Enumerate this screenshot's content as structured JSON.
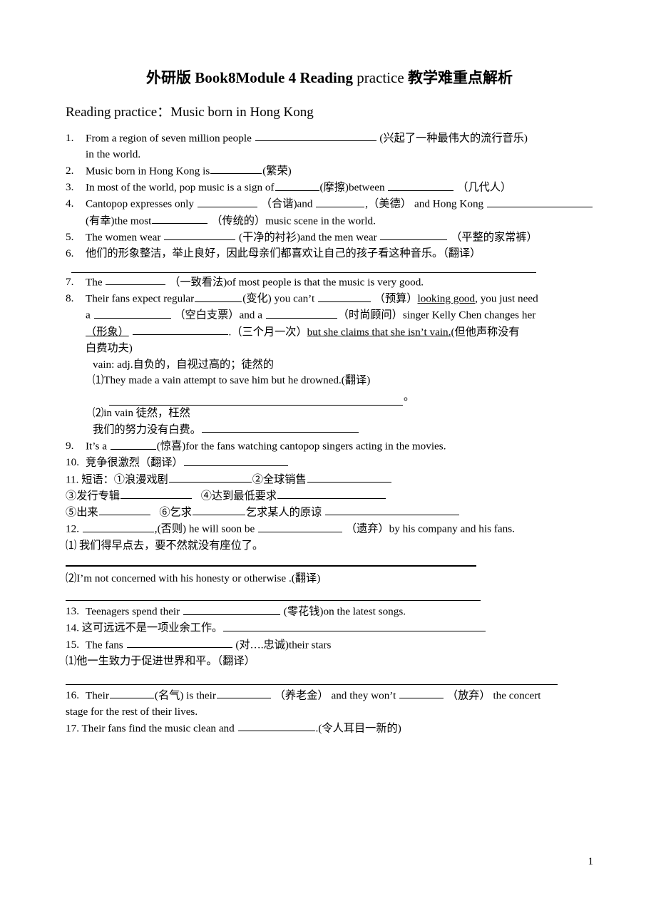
{
  "document": {
    "title_bold_cn_1": "外研版",
    "title_bold_en": "Book8Module 4 Reading",
    "title_light_en": "practice",
    "title_bold_cn_2": "教学难重点解析",
    "section_title": "Reading practice：Music born in Hong Kong",
    "page_number": "1"
  },
  "items": {
    "q1": {
      "num": "1.",
      "line1_a": "From a region of seven million people",
      "line1_b": "(兴起了一种最伟大的流行音乐)",
      "line2": "in the world."
    },
    "q2": {
      "num": "2.",
      "text_a": "Music born in Hong Kong is",
      "text_b": "(繁荣)"
    },
    "q3": {
      "num": "3.",
      "text_a": "In most of the world, pop music is a sign of",
      "text_b": "(摩擦)between",
      "text_c": "（几代人）"
    },
    "q4": {
      "num": "4.",
      "line1_a": "Cantopop expresses only",
      "line1_b": "（合谐)and",
      "line1_c": ",（美德） and Hong Kong",
      "line2_a": "(有幸)the most",
      "line2_b": "（传统的）music scene in the world."
    },
    "q5": {
      "num": "5.",
      "text_a": "The women wear",
      "text_b": "(干净的衬衫)and the men wear",
      "text_c": "（平整的家常裤）"
    },
    "q6": {
      "num": "6.",
      "text": "他们的形象整洁，举止良好，因此母亲们都喜欢让自己的孩子看这种音乐。（翻译）"
    },
    "q7": {
      "num": "7.",
      "text_a": "The",
      "text_b": "（一致看法)of most people is that the music is very good."
    },
    "q8": {
      "num": "8.",
      "line1_a": "Their fans expect regular",
      "line1_b": "(变化) you can’t",
      "line1_c": "（预算）",
      "line1_underlined": "looking good",
      "line1_d": ", you just need",
      "line2_a": "a",
      "line2_b": "（空白支票）and a",
      "line2_c": "（时尚顾问）singer Kelly Chen changes her",
      "line3_a": "（形象）",
      "line3_b": ".（三个月一次）",
      "line3_underlined": "but she claims that she isn’t vain.",
      "line3_c": "(但他声称没有",
      "line4": "白费功夫)",
      "gloss": "vain: adj.自负的，自视过高的；徒然的",
      "eg1": "⑴They made a vain attempt to save him but he drowned.(翻译)",
      "eg1_end": "。",
      "eg2": "⑵in vain  徒然，枉然",
      "eg2_cn": "我们的努力没有白费。"
    },
    "q9": {
      "num": "9.",
      "text_a": "It’s a",
      "text_b": "(惊喜)for the fans watching cantopop singers acting in the movies."
    },
    "q10": {
      "num": "10.",
      "text": "竞争很激烈（翻译）"
    },
    "q11": {
      "num": "11.",
      "line1_a": "短语：①浪漫戏剧",
      "line1_b": "②全球销售",
      "line2_a": "③发行专辑",
      "line2_b": "④达到最低要求",
      "line3_a": "⑤出来",
      "line3_b": "⑥乞求",
      "line3_c": "乞求某人的原谅"
    },
    "q12": {
      "num": "12.",
      "text_a": ",(否则) he will soon be",
      "text_b": "（遗弃）by his company and his fans.",
      "sub1": "⑴ 我们得早点去，要不然就没有座位了。",
      "sub2": "⑵I’m not concerned with his honesty or otherwise .(翻译)"
    },
    "q13": {
      "num": "13.",
      "text_a": "Teenagers spend their",
      "text_b": "(零花钱)on the latest songs."
    },
    "q14": {
      "num": "14.",
      "text": "这可远远不是一项业余工作。"
    },
    "q15": {
      "num": "15.",
      "text_a": "The fans",
      "text_b": "(对….忠诚)their stars",
      "sub1": "⑴他一生致力于促进世界和平。（翻译）"
    },
    "q16": {
      "num": "16.",
      "line1_a": "Their",
      "line1_b": "(名气) is their",
      "line1_c": "（养老金）  and they won’t",
      "line1_d": "（放弃）  the concert",
      "line2": "stage for the rest of their lives."
    },
    "q17": {
      "num": "17.",
      "text_a": "Their fans find the music clean and",
      "text_b": ".(令人耳目一新的)"
    }
  }
}
